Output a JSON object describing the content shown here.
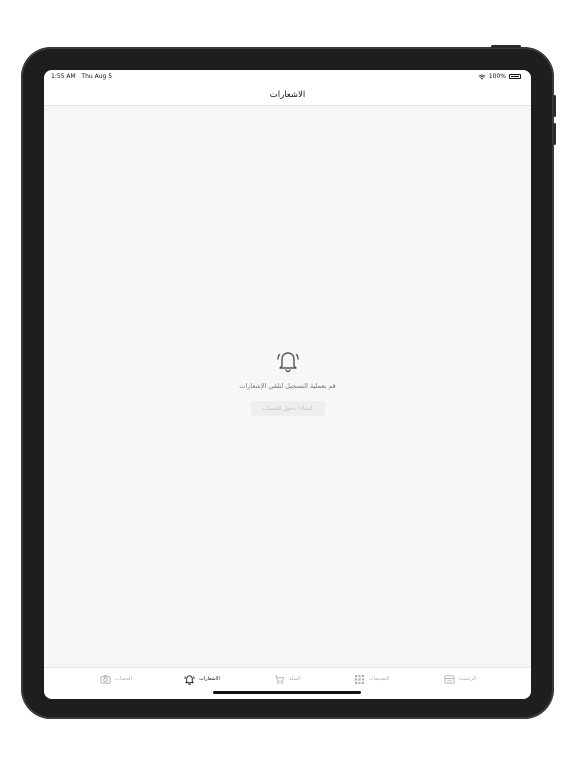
{
  "status_bar": {
    "time": "1:55 AM",
    "date": "Thu Aug 5",
    "battery": "100%"
  },
  "navbar": {
    "title": "الاشعارات"
  },
  "empty_state": {
    "icon": "bell-icon",
    "message": "قم بعملية التسجيل لتلقي الإشعارات",
    "login_button": "انشاء / دخول للحساب"
  },
  "tabbar": {
    "items": [
      {
        "label": "الحساب",
        "icon": "camera-icon",
        "active": false
      },
      {
        "label": "الاشعارات",
        "icon": "bell-icon",
        "active": true
      },
      {
        "label": "السلة",
        "icon": "cart-icon",
        "active": false
      },
      {
        "label": "التصنيفات",
        "icon": "grid-icon",
        "active": false
      },
      {
        "label": "الرئيسية",
        "icon": "home-icon",
        "active": false
      }
    ]
  },
  "colors": {
    "background": "#f7f7f9",
    "active_tab": "#111111",
    "inactive_tab": "#b0b0b5",
    "device_frame": "#1e1e20"
  }
}
